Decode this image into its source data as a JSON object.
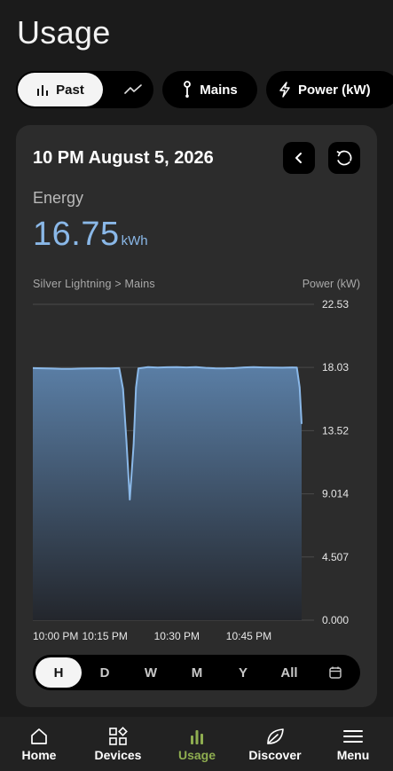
{
  "page": {
    "title": "Usage"
  },
  "filters": {
    "mode_past_label": "Past",
    "mains_label": "Mains",
    "power_label": "Power (kW)"
  },
  "card": {
    "date": "10 PM August 5, 2026",
    "energy_label": "Energy",
    "energy_value": "16.75",
    "energy_unit": "kWh",
    "breadcrumb": "Silver Lightning > Mains",
    "y_unit": "Power (kW)"
  },
  "ranges": {
    "items": [
      "H",
      "D",
      "W",
      "M",
      "Y",
      "All"
    ],
    "active": "H"
  },
  "nav": {
    "items": [
      "Home",
      "Devices",
      "Usage",
      "Discover",
      "Menu"
    ],
    "active": "Usage"
  },
  "colors": {
    "accent": "#8ab8e8",
    "nav_active": "#8fae50",
    "card_bg": "#2c2c2c"
  },
  "chart_data": {
    "type": "area",
    "title": "",
    "xlabel": "",
    "ylabel": "Power (kW)",
    "ylim": [
      0,
      22.53
    ],
    "yticks": [
      "22.53",
      "18.03",
      "13.52",
      "9.014",
      "4.507",
      "0.000"
    ],
    "ytick_values": [
      22.53,
      18.03,
      13.52,
      9.014,
      4.507,
      0
    ],
    "xticks": [
      "10:00 PM",
      "10:15 PM",
      "10:30 PM",
      "10:45 PM"
    ],
    "xtick_values": [
      0,
      15,
      30,
      45
    ],
    "xlim": [
      0,
      56
    ],
    "series": [
      {
        "values_x": [
          0,
          2,
          4,
          6,
          8,
          10,
          12,
          14,
          16,
          18,
          18.8,
          19.5,
          20.2,
          21,
          21.5,
          22,
          24,
          26,
          28,
          30,
          32,
          34,
          36,
          38,
          40,
          42,
          44,
          46,
          48,
          50,
          52,
          54,
          55,
          55.6,
          56
        ],
        "values_y": [
          17.98,
          17.97,
          17.95,
          17.93,
          17.92,
          17.95,
          17.96,
          17.97,
          17.96,
          17.98,
          16.5,
          12.8,
          8.6,
          12.5,
          16.6,
          17.96,
          18.05,
          18.02,
          18.04,
          18.05,
          18.03,
          18.05,
          18.0,
          17.97,
          17.96,
          17.98,
          18.03,
          18.05,
          18.03,
          18.02,
          18.01,
          18.03,
          18.02,
          16.6,
          14.0
        ]
      }
    ],
    "grid": true
  }
}
